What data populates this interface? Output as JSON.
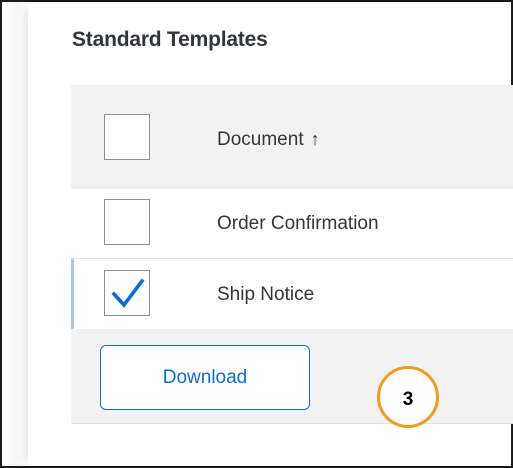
{
  "section": {
    "title": "Standard Templates"
  },
  "table": {
    "header": {
      "column_label": "Document",
      "sort_icon": "arrow-up-icon",
      "sort_glyph": "🠕"
    },
    "rows": [
      {
        "label": "Order Confirmation",
        "checked": false
      },
      {
        "label": "Ship Notice",
        "checked": true
      }
    ]
  },
  "actions": {
    "download_label": "Download"
  },
  "annotation": {
    "step_number": "3",
    "color": "#f39b1c"
  },
  "colors": {
    "accent": "#0a6ed1",
    "header_bg": "#f2f2f2",
    "selection_bar": "#a8c6ea"
  }
}
